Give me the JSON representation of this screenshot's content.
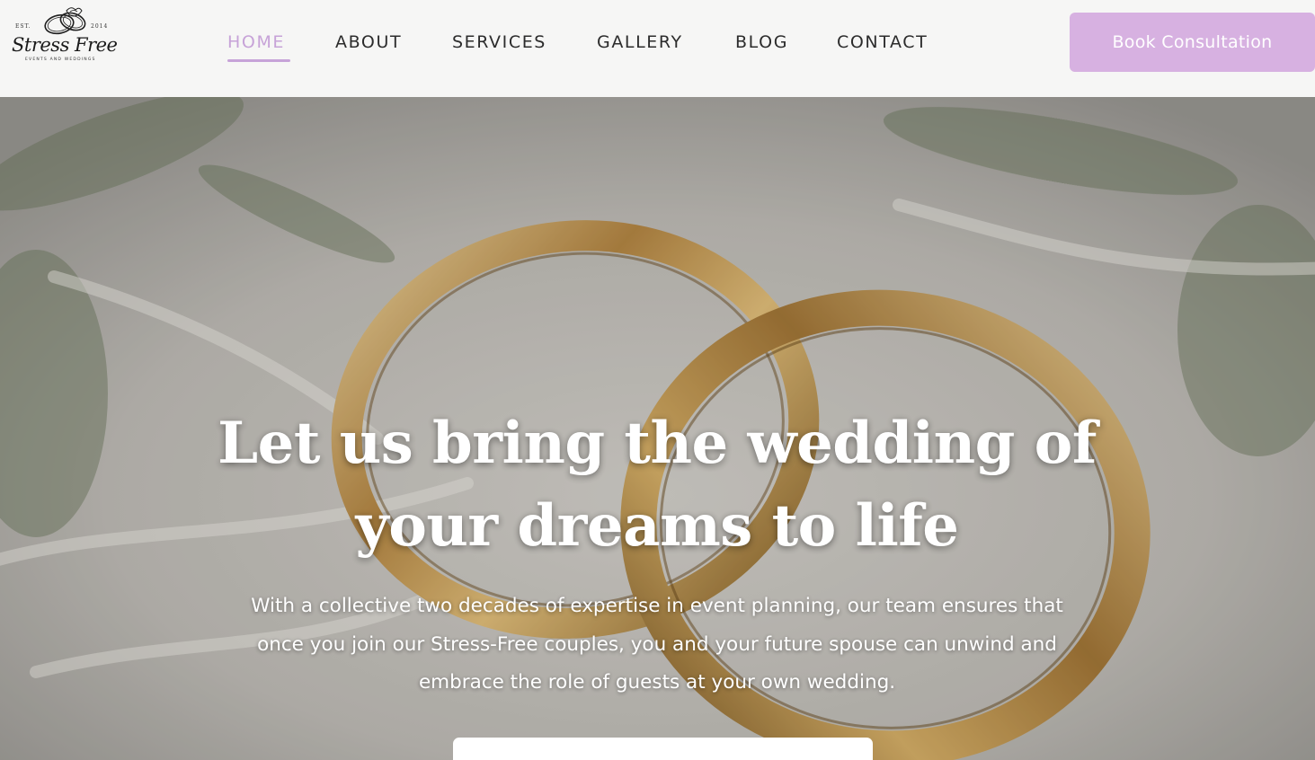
{
  "logo": {
    "est": "EST.",
    "year": "2014",
    "name": "Stress Free",
    "tagline": "EVENTS AND WEDDINGS",
    "icon": "wedding-rings-icon"
  },
  "nav": {
    "items": [
      {
        "label": "HOME",
        "active": true
      },
      {
        "label": "ABOUT",
        "active": false
      },
      {
        "label": "SERVICES",
        "active": false
      },
      {
        "label": "GALLERY",
        "active": false
      },
      {
        "label": "BLOG",
        "active": false
      },
      {
        "label": "CONTACT",
        "active": false
      }
    ],
    "active_color": "#c7a3d8"
  },
  "header": {
    "cta_label": "Book Consultation",
    "cta_color": "#d7b1e1"
  },
  "hero": {
    "title": "Let us bring the wedding of your dreams to life",
    "subtitle": "With a collective two decades of expertise in event planning, our team ensures that once you join our Stress-Free couples, you and your future spouse can unwind and embrace the role of guests at your own wedding.",
    "background": "gold-wedding-rings-photo"
  }
}
